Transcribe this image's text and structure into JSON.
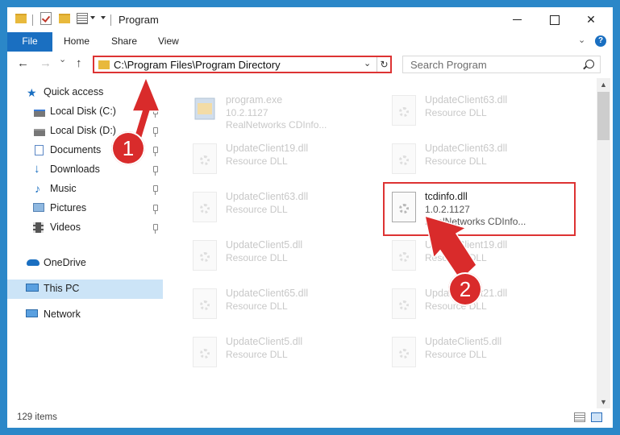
{
  "window": {
    "title": "Program",
    "controls": {
      "minimize": "—",
      "maximize": "☐",
      "close": "✕"
    }
  },
  "ribbon": {
    "tabs": [
      "File",
      "Home",
      "Share",
      "View"
    ],
    "help": "?"
  },
  "navbar": {
    "back": "←",
    "forward": "→",
    "recent": "⌄",
    "up": "↑",
    "address": "C:\\Program Files\\Program Directory",
    "refresh": "↻",
    "dropdown": "⌄",
    "search_placeholder": "Search Program"
  },
  "sidebar": {
    "items": [
      {
        "label": "Quick access",
        "icon": "star-icon"
      },
      {
        "label": "Local Disk (C:)",
        "icon": "drive-icon",
        "pinned": true
      },
      {
        "label": "Local Disk (D:)",
        "icon": "drive-icon",
        "pinned": true
      },
      {
        "label": "Documents",
        "icon": "documents-icon",
        "pinned": true
      },
      {
        "label": "Downloads",
        "icon": "downloads-icon",
        "pinned": true
      },
      {
        "label": "Music",
        "icon": "music-icon",
        "pinned": true
      },
      {
        "label": "Pictures",
        "icon": "pictures-icon",
        "pinned": true
      },
      {
        "label": "Videos",
        "icon": "videos-icon",
        "pinned": true
      },
      {
        "label": "OneDrive",
        "icon": "cloud-icon"
      },
      {
        "label": "This PC",
        "icon": "computer-icon",
        "selected": true
      },
      {
        "label": "Network",
        "icon": "network-icon"
      }
    ]
  },
  "files": [
    {
      "name": "program.exe",
      "line2": "10.2.1127",
      "line3": "RealNetworks CDInfo..."
    },
    {
      "name": "UpdateClient63.dll",
      "line2": "Resource DLL"
    },
    {
      "name": "UpdateClient19.dll",
      "line2": "Resource DLL"
    },
    {
      "name": "UpdateClient63.dll",
      "line2": "Resource DLL"
    },
    {
      "name": "UpdateClient63.dll",
      "line2": "Resource DLL"
    },
    {
      "name": "tcdinfo.dll",
      "line2": "1.0.2.1127",
      "line3": "RealNetworks CDInfo..."
    },
    {
      "name": "UpdateClient5.dll",
      "line2": "Resource DLL"
    },
    {
      "name": "UpdateClient19.dll",
      "line2": "Resource DLL"
    },
    {
      "name": "UpdateClient65.dll",
      "line2": "Resource DLL"
    },
    {
      "name": "UpdateClient21.dll",
      "line2": "Resource DLL"
    },
    {
      "name": "UpdateClient5.dll",
      "line2": "Resource DLL"
    },
    {
      "name": "UpdateClient5.dll",
      "line2": "Resource DLL"
    }
  ],
  "annotations": {
    "step1": "1",
    "step2": "2"
  },
  "status": {
    "item_count": "129 items"
  },
  "colors": {
    "accent": "#1a6fc1",
    "highlight": "#d33333",
    "selected_bg": "#cce4f7",
    "badge": "#d92b2b"
  }
}
